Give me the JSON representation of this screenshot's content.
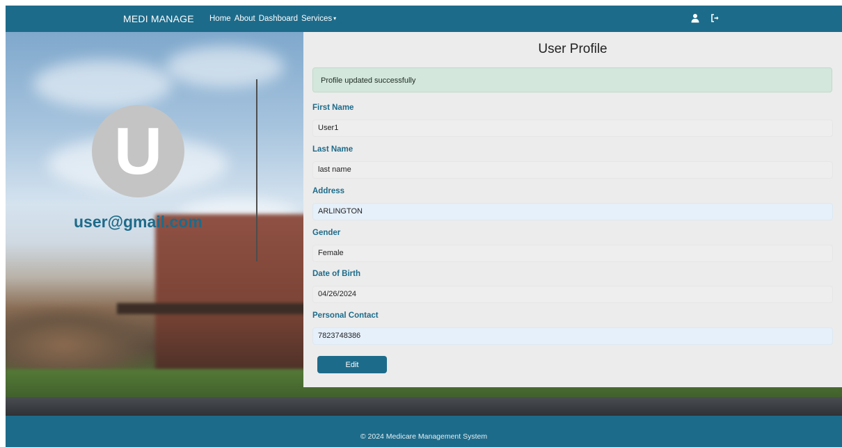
{
  "navbar": {
    "brand": "MEDI MANAGE",
    "links": [
      "Home",
      "About",
      "Dashboard",
      "Services"
    ],
    "services_caret": "▾",
    "icons": [
      "user-icon",
      "logout-icon"
    ]
  },
  "profile": {
    "avatar_letter": "U",
    "email": "user@gmail.com"
  },
  "panel": {
    "title": "User Profile",
    "alert": "Profile updated successfully",
    "fields": [
      {
        "label": "First Name",
        "value": "User1"
      },
      {
        "label": "Last Name",
        "value": "last name"
      },
      {
        "label": "Address",
        "value": "ARLINGTON"
      },
      {
        "label": "Gender",
        "value": "Female"
      },
      {
        "label": "Date of Birth",
        "value": "04/26/2024"
      },
      {
        "label": "Personal Contact",
        "value": "7823748386"
      }
    ],
    "edit_label": "Edit"
  },
  "footer": {
    "text": "© 2024 Medicare Management System"
  },
  "colors": {
    "primary": "#1d6b8a",
    "alert_bg": "#d3e7dc",
    "editable_field_bg": "#e6f0fb"
  }
}
